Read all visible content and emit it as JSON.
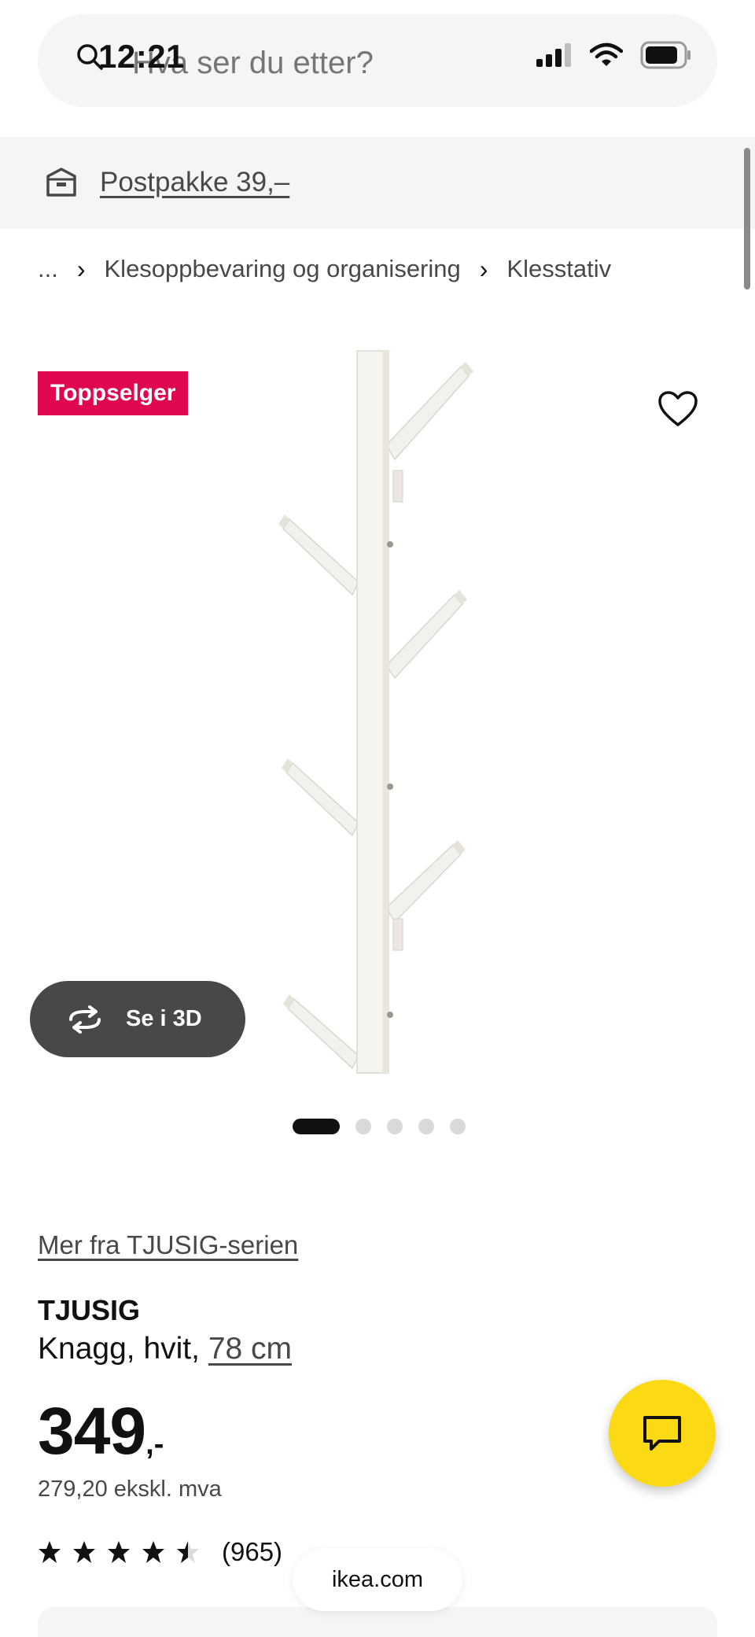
{
  "status_bar": {
    "time": "12:21"
  },
  "search": {
    "placeholder": "Hva ser du etter?"
  },
  "delivery": {
    "label": "Postpakke 39,–"
  },
  "breadcrumb": {
    "items": [
      "...",
      "Klesoppbevaring og organisering",
      "Klesstativ"
    ]
  },
  "product_image": {
    "badge": "Toppselger",
    "view_3d_label": "Se i 3D",
    "carousel": {
      "total": 5,
      "active_index": 0
    }
  },
  "product": {
    "series_link": "Mer fra TJUSIG-serien",
    "name": "TJUSIG",
    "description": "Knagg, hvit, ",
    "size": "78 cm",
    "price_integer": "349",
    "price_decimals": ",-",
    "price_ex_vat": "279,20 ekskl. mva",
    "rating": {
      "value": 4.5,
      "max": 5,
      "count": "(965)"
    }
  },
  "browser": {
    "domain": "ikea.com"
  },
  "colors": {
    "badge": "#e00751",
    "chat_button": "#fbd914",
    "dark_button": "#484848"
  }
}
